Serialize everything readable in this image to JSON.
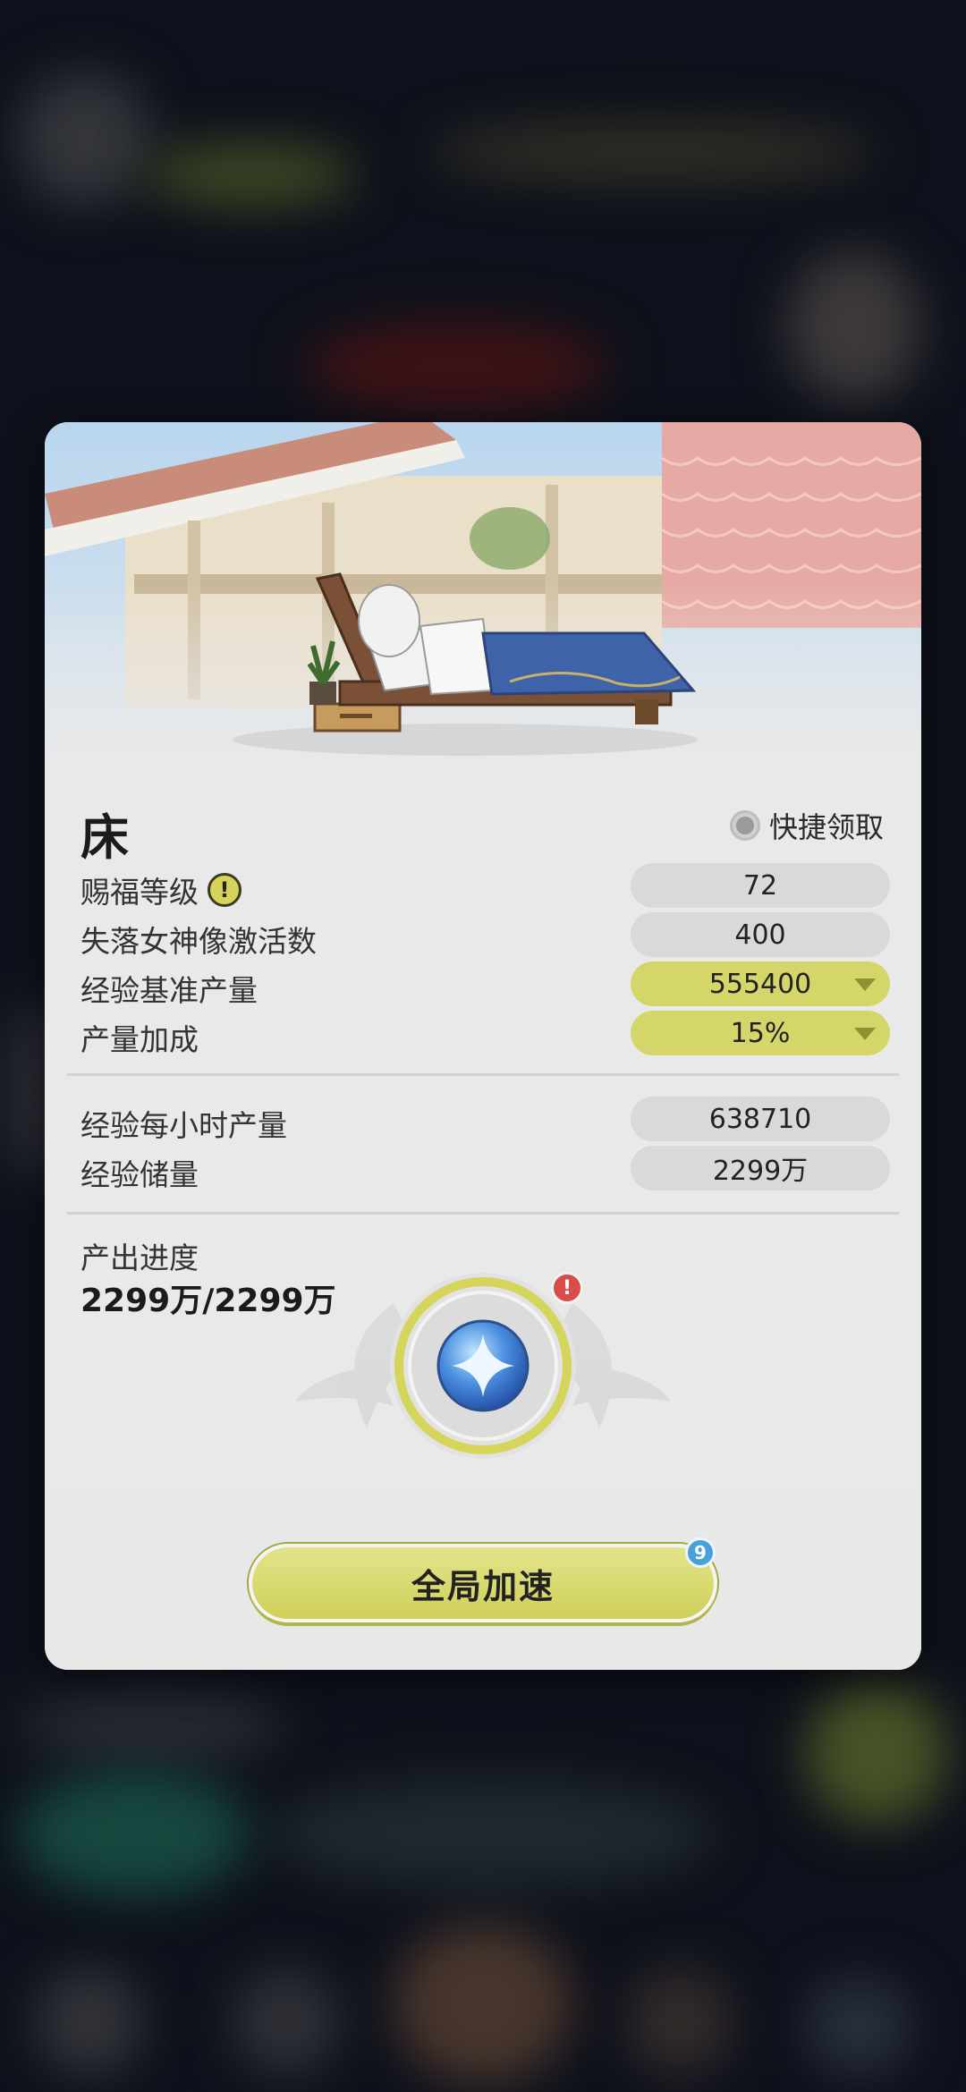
{
  "building": {
    "title": "床",
    "quick_collect_label": "快捷领取"
  },
  "stats": [
    {
      "label": "赐福等级",
      "value": "72",
      "style": "gray",
      "info_icon": true
    },
    {
      "label": "失落女神像激活数",
      "value": "400",
      "style": "gray"
    },
    {
      "label": "经验基准产量",
      "value": "555400",
      "style": "yellow",
      "dropdown": true
    },
    {
      "label": "产量加成",
      "value": "15%",
      "style": "yellow",
      "dropdown": true
    }
  ],
  "output": [
    {
      "label": "经验每小时产量",
      "value": "638710"
    },
    {
      "label": "经验储量",
      "value": "2299万"
    }
  ],
  "progress": {
    "label": "产出进度",
    "value": "2299万/2299万",
    "fraction": 1.0
  },
  "alert_icon": "!",
  "global_speed_button": {
    "label": "全局加速",
    "badge_count": "9"
  },
  "icons": [
    "info-icon",
    "radio-icon",
    "dropdown-arrow-icon",
    "alert-icon",
    "exp-orb-icon",
    "bed-illustration"
  ],
  "colors": {
    "accent_yellow": "#d5d66a",
    "panel_bg": "#e9e9e9",
    "pill_gray": "#d9d9d9",
    "badge_blue": "#4aa0d9",
    "alert_red": "#d94c4c"
  }
}
